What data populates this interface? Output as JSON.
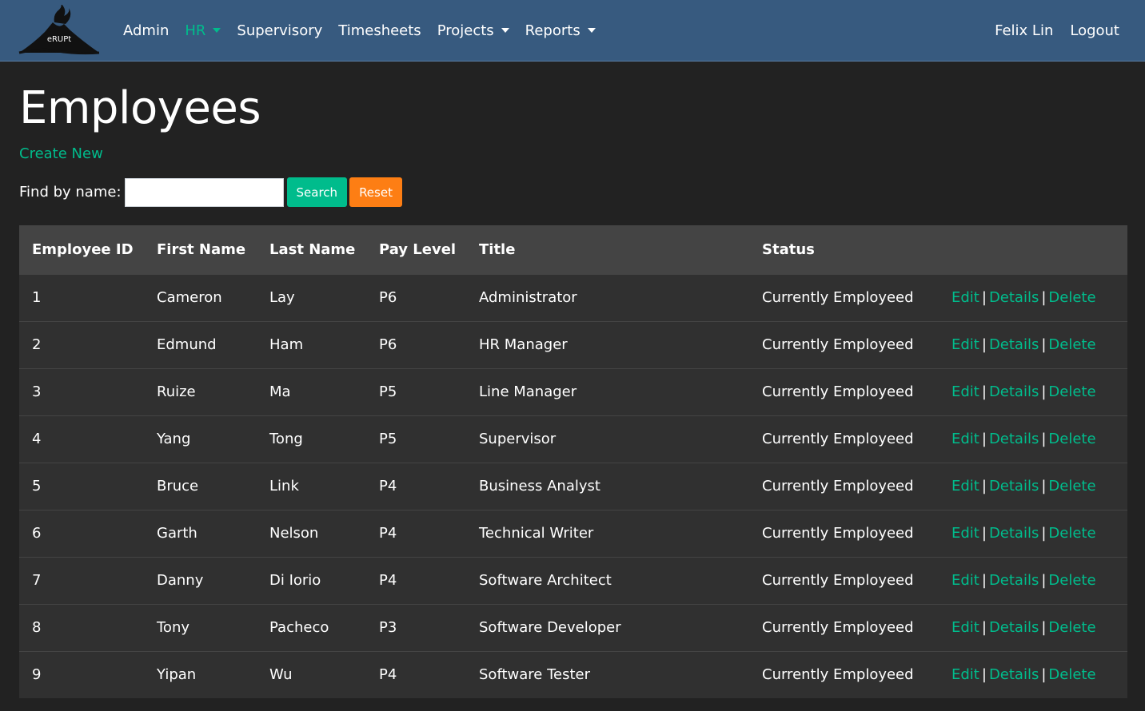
{
  "nav": {
    "brand_text": "eRUPt",
    "items": [
      {
        "label": "Admin",
        "active": false,
        "dropdown": false
      },
      {
        "label": "HR",
        "active": true,
        "dropdown": true
      },
      {
        "label": "Supervisory",
        "active": false,
        "dropdown": false
      },
      {
        "label": "Timesheets",
        "active": false,
        "dropdown": false
      },
      {
        "label": "Projects",
        "active": false,
        "dropdown": true
      },
      {
        "label": "Reports",
        "active": false,
        "dropdown": true
      }
    ],
    "user": "Felix Lin",
    "logout": "Logout"
  },
  "page": {
    "title": "Employees",
    "create_new": "Create New"
  },
  "search": {
    "label": "Find by name:",
    "value": "",
    "search_label": "Search",
    "reset_label": "Reset"
  },
  "table": {
    "headers": [
      "Employee ID",
      "First Name",
      "Last Name",
      "Pay Level",
      "Title",
      "Status"
    ],
    "action_labels": {
      "edit": "Edit",
      "details": "Details",
      "delete": "Delete",
      "separator": "|"
    },
    "rows": [
      {
        "id": "1",
        "first": "Cameron",
        "last": "Lay",
        "pay": "P6",
        "title": "Administrator",
        "status": "Currently Employeed"
      },
      {
        "id": "2",
        "first": "Edmund",
        "last": "Ham",
        "pay": "P6",
        "title": "HR Manager",
        "status": "Currently Employeed"
      },
      {
        "id": "3",
        "first": "Ruize",
        "last": "Ma",
        "pay": "P5",
        "title": "Line Manager",
        "status": "Currently Employeed"
      },
      {
        "id": "4",
        "first": "Yang",
        "last": "Tong",
        "pay": "P5",
        "title": "Supervisor",
        "status": "Currently Employeed"
      },
      {
        "id": "5",
        "first": "Bruce",
        "last": "Link",
        "pay": "P4",
        "title": "Business Analyst",
        "status": "Currently Employeed"
      },
      {
        "id": "6",
        "first": "Garth",
        "last": "Nelson",
        "pay": "P4",
        "title": "Technical Writer",
        "status": "Currently Employeed"
      },
      {
        "id": "7",
        "first": "Danny",
        "last": "Di Iorio",
        "pay": "P4",
        "title": "Software Architect",
        "status": "Currently Employeed"
      },
      {
        "id": "8",
        "first": "Tony",
        "last": "Pacheco",
        "pay": "P3",
        "title": "Software Developer",
        "status": "Currently Employeed"
      },
      {
        "id": "9",
        "first": "Yipan",
        "last": "Wu",
        "pay": "P4",
        "title": "Software Tester",
        "status": "Currently Employeed"
      }
    ]
  },
  "colors": {
    "navbar": "#375a7f",
    "accent": "#00bc8c",
    "reset": "#fd7e14",
    "background": "#222222",
    "table_header": "#444444",
    "table_body": "#303030"
  }
}
